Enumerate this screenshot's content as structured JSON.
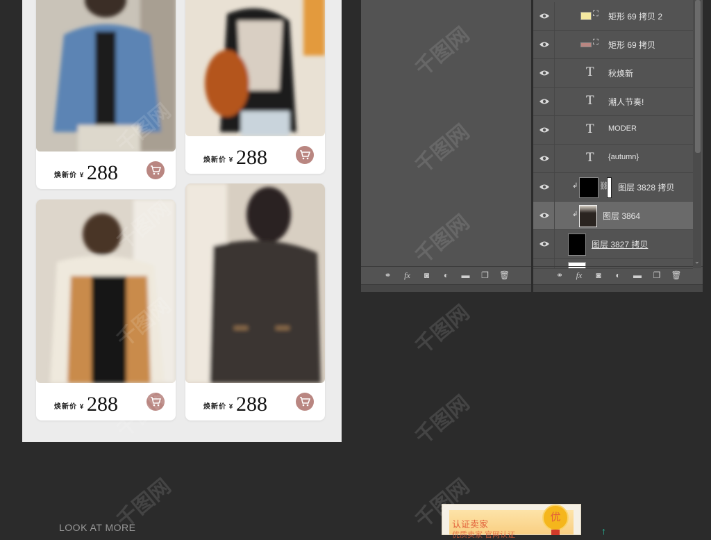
{
  "products": [
    {
      "price_label": "焕新价 ¥",
      "price": "288"
    },
    {
      "price_label": "焕新价 ¥",
      "price": "288"
    },
    {
      "price_label": "焕新价 ¥",
      "price": "288"
    },
    {
      "price_label": "焕新价 ¥",
      "price": "288"
    }
  ],
  "look_more": "LOOK AT MORE",
  "layers": [
    {
      "name": "矩形 69 拷贝 2",
      "kind": "shape",
      "swatch": "#f4e8a0"
    },
    {
      "name": "矩形 69 拷贝",
      "kind": "shape",
      "swatch": "#b98681"
    },
    {
      "name": "秋焕新",
      "kind": "text"
    },
    {
      "name": "潮人节奏!",
      "kind": "text"
    },
    {
      "name": "MODER",
      "kind": "text"
    },
    {
      "name": "{autumn}",
      "kind": "text"
    },
    {
      "name": "图层 3828 拷贝",
      "kind": "masked"
    },
    {
      "name": "图层 3864",
      "kind": "image"
    },
    {
      "name": "图层 3827 拷贝",
      "kind": "fill"
    }
  ],
  "cert": {
    "title": "认证卖家",
    "subtitle": "优质卖家 官网认证",
    "badge": "优"
  },
  "watermark": "千图网",
  "colors": {
    "accent": "#b98681",
    "panel": "#535353",
    "background": "#2b2b2b"
  }
}
